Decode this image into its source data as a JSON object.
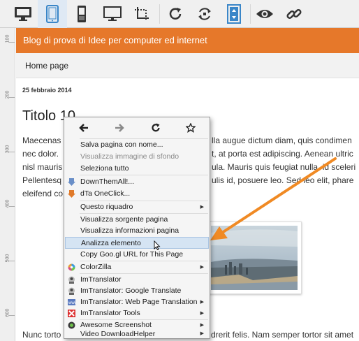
{
  "toolbar": {
    "buttons": [
      {
        "name": "desktop-icon"
      },
      {
        "name": "tablet-icon"
      },
      {
        "name": "mobile-icon"
      },
      {
        "name": "monitor-icon"
      },
      {
        "name": "crop-icon"
      },
      {
        "name": "reload-icon"
      },
      {
        "name": "rotate-icon"
      },
      {
        "name": "resize-icon"
      },
      {
        "name": "eye-icon"
      },
      {
        "name": "link-icon"
      }
    ],
    "active": "tablet-icon",
    "icon_color": "#333333",
    "active_color": "#3a86c8"
  },
  "ruler": {
    "labels": [
      "100",
      "200",
      "300",
      "400",
      "500",
      "600"
    ]
  },
  "blog": {
    "header_title": "Blog di prova di Idee per computer ed internet",
    "header_color": "#e6782a",
    "nav_home": "Home page",
    "post_date": "25 febbraio 2014",
    "post_title": "Titolo 10",
    "lines_left": [
      "Maecenas",
      "nec dolor.",
      "nisl mauris",
      "Pellentesq",
      "eleifend co"
    ],
    "lines_right": [
      "lla augue dictum diam, quis condimen",
      "t, at porta est adipiscing. Aenean ultric",
      "ula. Mauris quis feugiat nulla, id sceleri",
      "ulis id, posuere leo. Sed leo elit, phare"
    ],
    "bottom_left": "Nunc torto",
    "bottom_right": "drerit felis. Nam semper tortor sit amet"
  },
  "context_menu": {
    "nav": [
      "back-icon",
      "forward-icon",
      "reload-icon",
      "bookmark-star-icon"
    ],
    "items": [
      {
        "label": "Salva pagina con nome...",
        "disabled": false
      },
      {
        "label": "Visualizza immagine di sfondo",
        "disabled": true
      },
      {
        "label": "Seleziona tutto",
        "disabled": false
      },
      {
        "label": "DownThemAll!...",
        "icon": "downthemall-icon"
      },
      {
        "label": "dTa OneClick...",
        "icon": "dta-oneclick-icon"
      },
      {
        "label": "Questo riquadro",
        "submenu": true
      },
      {
        "label": "Visualizza sorgente pagina"
      },
      {
        "label": "Visualizza informazioni pagina"
      },
      {
        "label": "Analizza elemento",
        "highlighted": true
      },
      {
        "label": "Copy Goo.gl URL for This Page"
      },
      {
        "label": "ColorZilla",
        "icon": "colorzilla-icon",
        "submenu": true
      },
      {
        "label": "ImTranslator",
        "icon": "imtranslator-icon"
      },
      {
        "label": "ImTranslator: Google Translate",
        "icon": "imtranslator-google-icon"
      },
      {
        "label": "ImTranslator: Web Page Translation",
        "icon": "imtranslator-web-icon",
        "submenu": true
      },
      {
        "label": "ImTranslator Tools",
        "icon": "imtranslator-tools-icon",
        "submenu": true
      },
      {
        "label": "Awesome Screenshot",
        "icon": "awesome-screenshot-icon",
        "submenu": true
      },
      {
        "label": "Video DownloadHelper",
        "submenu": true
      }
    ],
    "highlight_color": "#d5e4f3"
  },
  "annotation": {
    "arrow_color": "#f08a24"
  }
}
